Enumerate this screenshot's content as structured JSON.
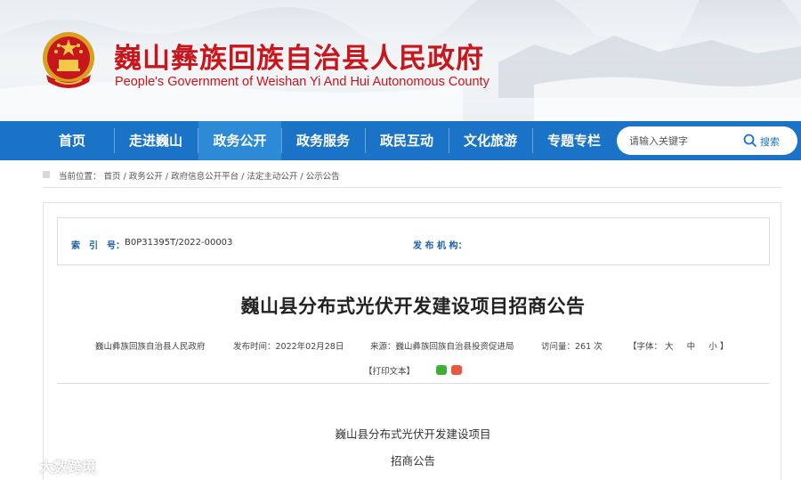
{
  "header": {
    "title_cn": "巍山彝族回族自治县人民政府",
    "title_en": "People's Government of Weishan Yi And Hui Autonomous County"
  },
  "nav": {
    "items": [
      {
        "label": "首页"
      },
      {
        "label": "走进巍山"
      },
      {
        "label": "政务公开",
        "active": true
      },
      {
        "label": "政务服务"
      },
      {
        "label": "政民互动"
      },
      {
        "label": "文化旅游"
      },
      {
        "label": "专题专栏"
      }
    ],
    "search_placeholder": "请输入关键字",
    "search_label": "搜索"
  },
  "breadcrumb": {
    "prefix": "当前位置：",
    "items": [
      "首页",
      "政务公开",
      "政府信息公开平台",
      "法定主动公开",
      "公示公告"
    ],
    "separator": " / "
  },
  "meta": {
    "index_label": "索　引　号：",
    "index_value": "B0P31395T/2022-00003",
    "publisher_label": "发 布 机 构："
  },
  "article": {
    "title": "巍山县分布式光伏开发建设项目招商公告",
    "org": "巍山彝族回族自治县人民政府",
    "publish_time": "发布时间：2022年02月28日",
    "source": "来源：巍山彝族回族自治县投资促进局",
    "views": "访问量：261 次",
    "font_size_label": "【字体：",
    "font_large": "大",
    "font_medium": "中",
    "font_small": "小",
    "font_close": "】",
    "print_label": "【打印文本】",
    "body_lines": [
      "巍山县分布式光伏开发建设项目",
      "招商公告"
    ]
  },
  "watermark": {
    "text": "大数跨境"
  },
  "colors": {
    "nav_bg": "#1a73c6",
    "nav_active": "#2c8ad6",
    "title_red": "#c8161d",
    "label_blue": "#1a5fa8"
  }
}
